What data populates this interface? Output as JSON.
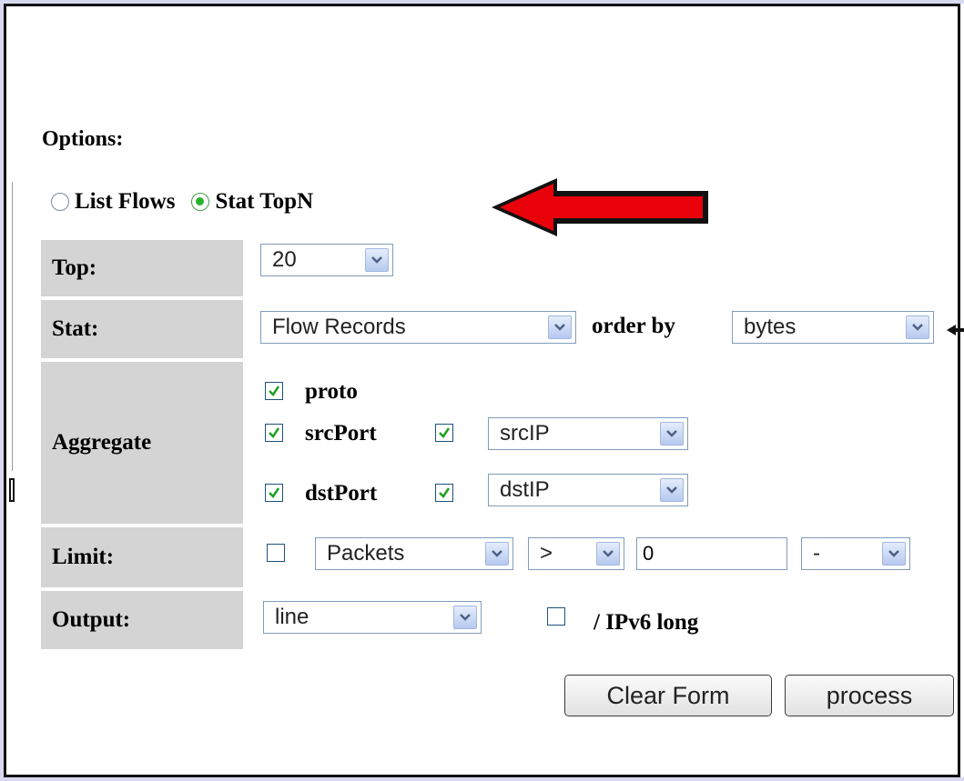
{
  "options": {
    "heading": "Options:",
    "modes": [
      {
        "label": "List Flows",
        "selected": false
      },
      {
        "label": "Stat TopN",
        "selected": true
      }
    ]
  },
  "form": {
    "top_label": "Top:",
    "top_value": "20",
    "stat_label": "Stat:",
    "stat_value": "Flow Records",
    "order_by_label": "order by",
    "order_by_value": "bytes",
    "aggregate_label": "Aggregate",
    "aggregate": {
      "proto": {
        "label": "proto",
        "checked": true
      },
      "srcport": {
        "label": "srcPort",
        "checked": true,
        "ip_checked": true,
        "ip_value": "srcIP"
      },
      "dstport": {
        "label": "dstPort",
        "checked": true,
        "ip_checked": true,
        "ip_value": "dstIP"
      }
    },
    "limit_label": "Limit:",
    "limit_checked": false,
    "limit_type": "Packets",
    "limit_operator": ">",
    "limit_value": "0",
    "limit_unit": "-",
    "output_label": "Output:",
    "output_value": "line",
    "ipv6_checked": false,
    "ipv6_label": "/ IPv6 long",
    "clear_button": "Clear Form",
    "process_button": "process"
  },
  "colors": {
    "frame_background": "#d8d8f0",
    "label_cell": "#d4d4d4",
    "annotation_arrow": "#e8000b",
    "radio_selected": "#27b32e"
  }
}
